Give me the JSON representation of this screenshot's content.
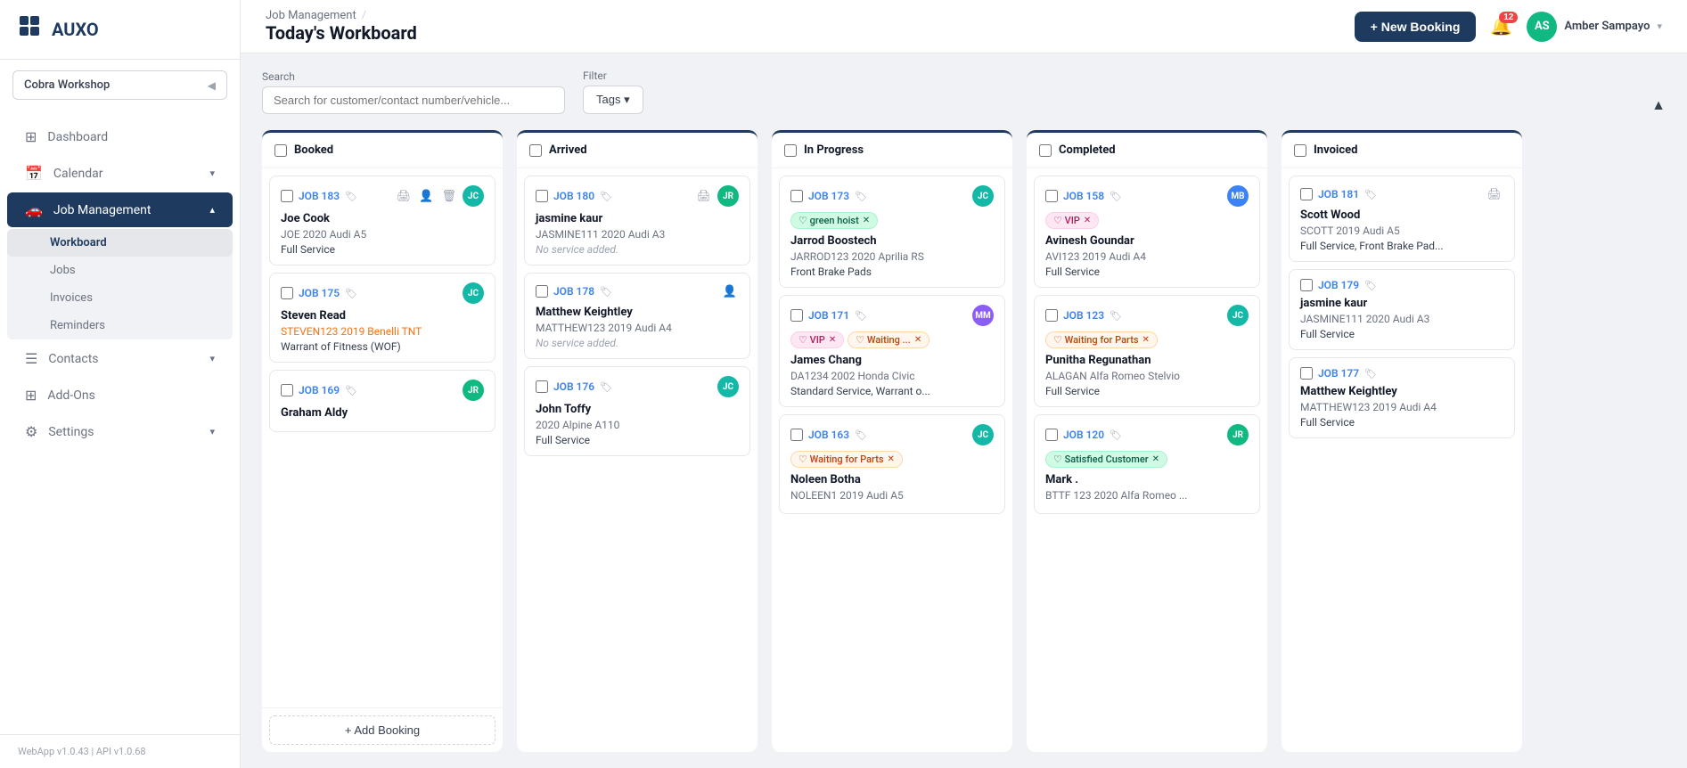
{
  "app": {
    "logo": "AUXO",
    "version": "WebApp v1.0.43 | API v1.0.68"
  },
  "workspace": {
    "name": "Cobra Workshop",
    "collapse_icon": "◀"
  },
  "sidebar": {
    "items": [
      {
        "id": "dashboard",
        "label": "Dashboard",
        "icon": "⊞",
        "active": false
      },
      {
        "id": "calendar",
        "label": "Calendar",
        "icon": "📅",
        "active": false,
        "arrow": "▾"
      },
      {
        "id": "job-management",
        "label": "Job Management",
        "icon": "🚗",
        "active": true,
        "arrow": "▴"
      },
      {
        "id": "workboard",
        "label": "Workboard",
        "sub": true,
        "active": true
      },
      {
        "id": "jobs",
        "label": "Jobs",
        "sub": true,
        "active": false
      },
      {
        "id": "invoices",
        "label": "Invoices",
        "sub": true,
        "active": false
      },
      {
        "id": "reminders",
        "label": "Reminders",
        "sub": true,
        "active": false
      },
      {
        "id": "contacts",
        "label": "Contacts",
        "icon": "☰",
        "active": false,
        "arrow": "▾"
      },
      {
        "id": "addons",
        "label": "Add-Ons",
        "icon": "⊞",
        "active": false
      },
      {
        "id": "settings",
        "label": "Settings",
        "icon": "⚙",
        "active": false,
        "arrow": "▾"
      }
    ]
  },
  "topbar": {
    "breadcrumb": [
      "Job Management",
      "/",
      "Today's Workboard"
    ],
    "page_title": "Today's Workboard",
    "new_booking_label": "+ New Booking",
    "notification_count": "12",
    "user": {
      "initials": "AS",
      "name": "Amber Sampayo",
      "avatar_bg": "#10b981"
    }
  },
  "search": {
    "label": "Search",
    "placeholder": "Search for customer/contact number/vehicle..."
  },
  "filter": {
    "label": "Filter",
    "tags_label": "Tags ▾"
  },
  "columns": [
    {
      "id": "booked",
      "title": "Booked",
      "cards": [
        {
          "job": "JOB 183",
          "name": "Joe Cook",
          "vehicle": "JOE 2020 Audi A5",
          "vehicle_highlight": false,
          "service": "Full Service",
          "service_italic": false,
          "assignee": "JC",
          "assignee_bg": "#14b8a6",
          "tags": [],
          "actions": [
            "print",
            "person",
            "trash"
          ]
        },
        {
          "job": "JOB 175",
          "name": "Steven Read",
          "vehicle": "STEVEN123 2019 Benelli TNT",
          "vehicle_highlight": true,
          "service": "Warrant of Fitness (WOF)",
          "service_italic": false,
          "assignee": "JC",
          "assignee_bg": "#14b8a6",
          "tags": [],
          "actions": []
        },
        {
          "job": "JOB 169",
          "name": "Graham Aldy",
          "vehicle": "",
          "vehicle_highlight": false,
          "service": "",
          "service_italic": false,
          "assignee": "JR",
          "assignee_bg": "#10b981",
          "tags": [],
          "actions": []
        }
      ],
      "show_add": true,
      "add_label": "+ Add Booking"
    },
    {
      "id": "arrived",
      "title": "Arrived",
      "cards": [
        {
          "job": "JOB 180",
          "name": "jasmine kaur",
          "vehicle": "JASMINE111 2020 Audi A3",
          "vehicle_highlight": false,
          "service": "No service added.",
          "service_italic": true,
          "assignee": "JR",
          "assignee_bg": "#10b981",
          "tags": [],
          "actions": [
            "print"
          ]
        },
        {
          "job": "JOB 178",
          "name": "Matthew Keightley",
          "vehicle": "MATTHEW123 2019 Audi A4",
          "vehicle_highlight": false,
          "service": "No service added.",
          "service_italic": true,
          "assignee": "",
          "assignee_bg": "",
          "tags": [],
          "actions": [
            "person"
          ]
        },
        {
          "job": "JOB 176",
          "name": "John Toffy",
          "vehicle": "2020 Alpine A110",
          "vehicle_highlight": false,
          "service": "Full Service",
          "service_italic": false,
          "assignee": "JC",
          "assignee_bg": "#14b8a6",
          "tags": [],
          "actions": []
        }
      ],
      "show_add": false
    },
    {
      "id": "in-progress",
      "title": "In Progress",
      "cards": [
        {
          "job": "JOB 173",
          "name": "Jarrod Boostech",
          "vehicle": "JARROD123 2020 Aprilia RS",
          "vehicle_highlight": false,
          "service": "Front Brake Pads",
          "service_italic": false,
          "assignee": "JC",
          "assignee_bg": "#14b8a6",
          "tags": [
            {
              "label": "green hoist",
              "type": "green-hoist"
            }
          ],
          "actions": []
        },
        {
          "job": "JOB 171",
          "name": "James Chang",
          "vehicle": "DA1234 2002 Honda Civic",
          "vehicle_highlight": false,
          "service": "Standard Service, Warrant o...",
          "service_italic": false,
          "assignee": "MM",
          "assignee_bg": "#8b5cf6",
          "tags": [
            {
              "label": "VIP",
              "type": "vip"
            },
            {
              "label": "Waiting ...",
              "type": "waiting"
            }
          ],
          "actions": []
        },
        {
          "job": "JOB 163",
          "name": "Noleen Botha",
          "vehicle": "NOLEEN1 2019 Audi A5",
          "vehicle_highlight": false,
          "service": "",
          "service_italic": false,
          "assignee": "JC",
          "assignee_bg": "#14b8a6",
          "tags": [
            {
              "label": "Waiting for Parts",
              "type": "waiting-parts"
            }
          ],
          "actions": []
        }
      ],
      "show_add": false
    },
    {
      "id": "completed",
      "title": "Completed",
      "cards": [
        {
          "job": "JOB 158",
          "name": "Avinesh Goundar",
          "vehicle": "AVI123 2019 Audi A4",
          "vehicle_highlight": false,
          "service": "Full Service",
          "service_italic": false,
          "assignee": "MB",
          "assignee_bg": "#3b82f6",
          "tags": [
            {
              "label": "VIP",
              "type": "vip"
            }
          ],
          "actions": []
        },
        {
          "job": "JOB 123",
          "name": "Punitha Regunathan",
          "vehicle": "ALAGAN Alfa Romeo Stelvio",
          "vehicle_highlight": false,
          "service": "Full Service",
          "service_italic": false,
          "assignee": "JC",
          "assignee_bg": "#14b8a6",
          "tags": [
            {
              "label": "Waiting for Parts",
              "type": "waiting-parts"
            }
          ],
          "actions": []
        },
        {
          "job": "JOB 120",
          "name": "Mark .",
          "vehicle": "BTTF 123 2020 Alfa Romeo ...",
          "vehicle_highlight": false,
          "service": "",
          "service_italic": false,
          "assignee": "JR",
          "assignee_bg": "#10b981",
          "tags": [
            {
              "label": "Satisfied Customer",
              "type": "satisfied"
            }
          ],
          "actions": []
        }
      ],
      "show_add": false
    },
    {
      "id": "invoiced",
      "title": "Invoiced",
      "cards": [
        {
          "job": "JOB 181",
          "name": "Scott Wood",
          "vehicle": "SCOTT 2019 Audi A5",
          "vehicle_highlight": false,
          "service": "Full Service, Front Brake Pad...",
          "service_italic": false,
          "assignee": "",
          "assignee_bg": "",
          "tags": [],
          "actions": [
            "print"
          ]
        },
        {
          "job": "JOB 179",
          "name": "jasmine kaur",
          "vehicle": "JASMINE111 2020 Audi A3",
          "vehicle_highlight": false,
          "service": "Full Service",
          "service_italic": false,
          "assignee": "",
          "assignee_bg": "",
          "tags": [],
          "actions": []
        },
        {
          "job": "JOB 177",
          "name": "Matthew Keightley",
          "vehicle": "MATTHEW123 2019 Audi A4",
          "vehicle_highlight": false,
          "service": "Full Service",
          "service_italic": false,
          "assignee": "",
          "assignee_bg": "",
          "tags": [],
          "actions": []
        }
      ],
      "show_add": false
    }
  ]
}
